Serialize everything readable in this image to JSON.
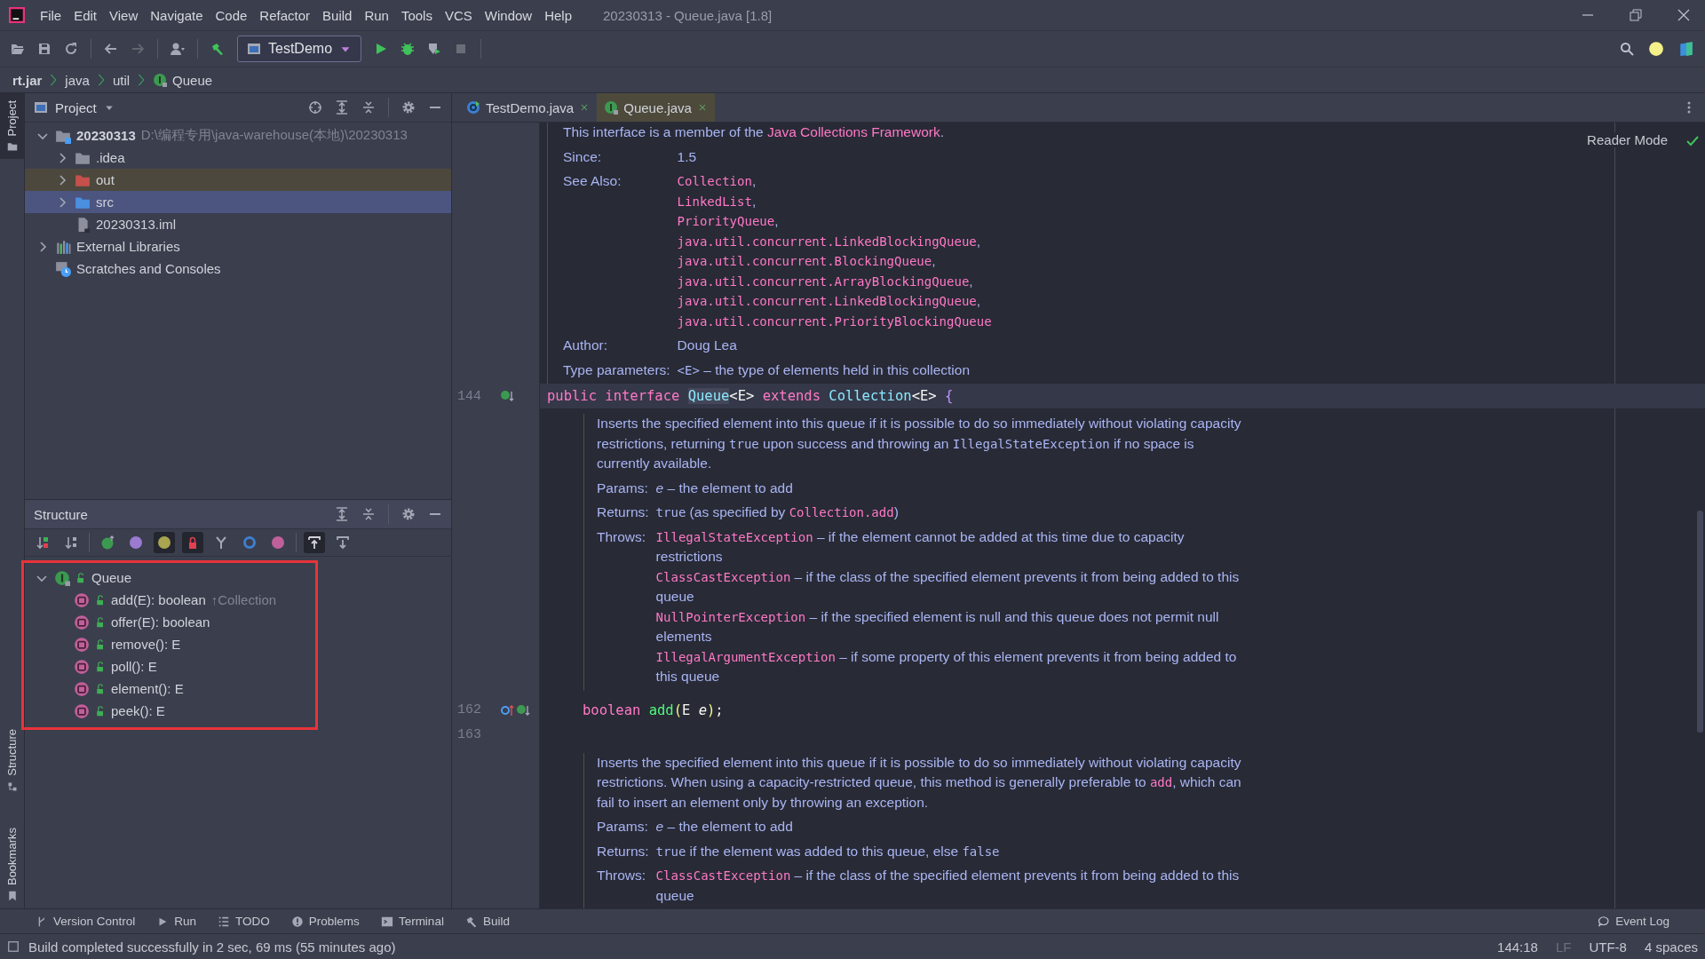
{
  "window": {
    "title": "20230313 - Queue.java [1.8]"
  },
  "menu": [
    "File",
    "Edit",
    "View",
    "Navigate",
    "Code",
    "Refactor",
    "Build",
    "Run",
    "Tools",
    "VCS",
    "Window",
    "Help"
  ],
  "toolbar": {
    "run_configuration": "TestDemo"
  },
  "breadcrumb": [
    {
      "label": "rt.jar",
      "bold": true,
      "kind": "jar"
    },
    {
      "label": "java",
      "bold": false,
      "kind": "package"
    },
    {
      "label": "util",
      "bold": false,
      "kind": "package"
    },
    {
      "label": "Queue",
      "bold": false,
      "kind": "interface"
    }
  ],
  "tool_stripe": [
    {
      "label": "Project",
      "selected": true,
      "kind": "project"
    },
    {
      "label": "Structure",
      "selected": false,
      "kind": "structure"
    },
    {
      "label": "Bookmarks",
      "selected": false,
      "kind": "bookmarks"
    }
  ],
  "project_panel": {
    "title": "Project",
    "tree": [
      {
        "label": "20230313",
        "path": "D:\\编程专用\\java-warehouse(本地)\\20230313",
        "kind": "module",
        "expanded": true,
        "selected": false,
        "children": [
          {
            "label": ".idea",
            "kind": "folder",
            "expanded": false,
            "selected": false
          },
          {
            "label": "out",
            "kind": "excluded",
            "expanded": false,
            "selected": false
          },
          {
            "label": "src",
            "kind": "source",
            "expanded": false,
            "selected": true
          },
          {
            "label": "20230313.iml",
            "kind": "file",
            "selected": false
          }
        ]
      },
      {
        "label": "External Libraries",
        "kind": "libraries",
        "expanded": false,
        "selected": false
      },
      {
        "label": "Scratches and Consoles",
        "kind": "scratches",
        "selected": false
      }
    ]
  },
  "structure_panel": {
    "title": "Structure",
    "highlighted": true,
    "tree": [
      {
        "label": "Queue",
        "kind": "interface",
        "expanded": true,
        "children": [
          {
            "label": "add(E): boolean",
            "kind": "method",
            "inherited_from": "↑Collection"
          },
          {
            "label": "offer(E): boolean",
            "kind": "method"
          },
          {
            "label": "remove(): E",
            "kind": "method"
          },
          {
            "label": "poll(): E",
            "kind": "method"
          },
          {
            "label": "element(): E",
            "kind": "method"
          },
          {
            "label": "peek(): E",
            "kind": "method"
          }
        ]
      }
    ]
  },
  "editor": {
    "tabs": [
      {
        "label": "TestDemo.java",
        "kind": "class",
        "selected": false
      },
      {
        "label": "Queue.java",
        "kind": "interface",
        "selected": true
      }
    ],
    "reader_mode": "Reader Mode",
    "blocks": [
      {
        "kind": "class-doc",
        "paragraph": [
          {
            "text": "This interface is a member of the ",
            "kind": "plain"
          },
          {
            "text": "Java Collections Framework",
            "kind": "link"
          },
          {
            "text": ".",
            "kind": "plain"
          }
        ],
        "fields": [
          {
            "label": "Since:",
            "lines": [
              [
                {
                  "text": "1.5",
                  "kind": "plain"
                }
              ]
            ]
          },
          {
            "label": "See Also:",
            "lines": [
              [
                {
                  "text": "Collection",
                  "kind": "code-link"
                },
                {
                  "text": ",",
                  "kind": "plain"
                }
              ],
              [
                {
                  "text": "LinkedList",
                  "kind": "code-link"
                },
                {
                  "text": ",",
                  "kind": "plain"
                }
              ],
              [
                {
                  "text": "PriorityQueue",
                  "kind": "code-link"
                },
                {
                  "text": ",",
                  "kind": "plain"
                }
              ],
              [
                {
                  "text": "java.util.concurrent.LinkedBlockingQueue",
                  "kind": "code-link"
                },
                {
                  "text": ",",
                  "kind": "plain"
                }
              ],
              [
                {
                  "text": "java.util.concurrent.BlockingQueue",
                  "kind": "code-link"
                },
                {
                  "text": ",",
                  "kind": "plain"
                }
              ],
              [
                {
                  "text": "java.util.concurrent.ArrayBlockingQueue",
                  "kind": "code-link"
                },
                {
                  "text": ",",
                  "kind": "plain"
                }
              ],
              [
                {
                  "text": "java.util.concurrent.LinkedBlockingQueue",
                  "kind": "code-link"
                },
                {
                  "text": ",",
                  "kind": "plain"
                }
              ],
              [
                {
                  "text": "java.util.concurrent.PriorityBlockingQueue",
                  "kind": "code-link"
                }
              ]
            ]
          },
          {
            "label": "Author:",
            "lines": [
              [
                {
                  "text": "Doug Lea",
                  "kind": "plain"
                }
              ]
            ]
          },
          {
            "label": "Type parameters:",
            "lines": [
              [
                {
                  "text": "<E>",
                  "kind": "code"
                },
                {
                  "text": " – the type of elements held in this collection",
                  "kind": "plain"
                }
              ]
            ]
          }
        ]
      },
      {
        "kind": "code",
        "number": "144",
        "current": true,
        "gutter_icons": [
          {
            "kind": "implemented"
          }
        ],
        "tokens": [
          {
            "text": "public interface ",
            "kind": "keyword"
          },
          {
            "text": "Queue",
            "kind": "usage"
          },
          {
            "text": "<E> ",
            "kind": "text"
          },
          {
            "text": "extends ",
            "kind": "keyword"
          },
          {
            "text": "Collection",
            "kind": "type"
          },
          {
            "text": "<E> ",
            "kind": "text"
          },
          {
            "text": "{",
            "kind": "brace"
          }
        ]
      },
      {
        "kind": "member-doc",
        "paragraph": [
          {
            "text": "Inserts the specified element into this queue if it is possible to do so immediately without violating capacity restrictions, returning ",
            "kind": "plain"
          },
          {
            "text": "true",
            "kind": "code"
          },
          {
            "text": " upon success and throwing an ",
            "kind": "plain"
          },
          {
            "text": "IllegalStateException",
            "kind": "code"
          },
          {
            "text": " if no space is currently available.",
            "kind": "plain"
          }
        ],
        "fields": [
          {
            "label": "Params:",
            "lines": [
              [
                {
                  "text": "e",
                  "kind": "italic"
                },
                {
                  "text": " – the element to add",
                  "kind": "plain"
                }
              ]
            ]
          },
          {
            "label": "Returns:",
            "lines": [
              [
                {
                  "text": "true",
                  "kind": "code"
                },
                {
                  "text": " (as specified by ",
                  "kind": "plain"
                },
                {
                  "text": "Collection.add",
                  "kind": "code-link"
                },
                {
                  "text": ")",
                  "kind": "plain"
                }
              ]
            ]
          },
          {
            "label": "Throws:",
            "lines": [
              [
                {
                  "text": "IllegalStateException",
                  "kind": "code-link"
                },
                {
                  "text": " – if the element cannot be added at this time due to capacity restrictions",
                  "kind": "plain"
                }
              ],
              [
                {
                  "text": "ClassCastException",
                  "kind": "code-link"
                },
                {
                  "text": " – if the class of the specified element prevents it from being added to this queue",
                  "kind": "plain"
                }
              ],
              [
                {
                  "text": "NullPointerException",
                  "kind": "code-link"
                },
                {
                  "text": " – if the specified element is null and this queue does not permit null elements",
                  "kind": "plain"
                }
              ],
              [
                {
                  "text": "IllegalArgumentException",
                  "kind": "code-link"
                },
                {
                  "text": " – if some property of this element prevents it from being added to this queue",
                  "kind": "plain"
                }
              ]
            ]
          }
        ]
      },
      {
        "kind": "member-code",
        "number": "162",
        "current": false,
        "gutter_icons": [
          {
            "kind": "overrides"
          },
          {
            "kind": "implemented"
          }
        ],
        "tokens": [
          {
            "text": "boolean ",
            "kind": "keyword"
          },
          {
            "text": "add",
            "kind": "method"
          },
          {
            "text": "(",
            "kind": "paren"
          },
          {
            "text": "E ",
            "kind": "text"
          },
          {
            "text": "e",
            "kind": "param"
          },
          {
            "text": ")",
            "kind": "paren"
          },
          {
            "text": ";",
            "kind": "text"
          }
        ]
      },
      {
        "kind": "member-code",
        "number": "163",
        "current": false
      },
      {
        "kind": "member-doc",
        "paragraph": [
          {
            "text": "Inserts the specified element into this queue if it is possible to do so immediately without violating capacity restrictions. When using a capacity-restricted queue, this method is generally preferable to ",
            "kind": "plain"
          },
          {
            "text": "add",
            "kind": "code-link"
          },
          {
            "text": ", which can fail to insert an element only by throwing an exception.",
            "kind": "plain"
          }
        ],
        "fields": [
          {
            "label": "Params:",
            "lines": [
              [
                {
                  "text": "e",
                  "kind": "italic"
                },
                {
                  "text": " – the element to add",
                  "kind": "plain"
                }
              ]
            ]
          },
          {
            "label": "Returns:",
            "lines": [
              [
                {
                  "text": "true",
                  "kind": "code"
                },
                {
                  "text": " if the element was added to this queue, else ",
                  "kind": "plain"
                },
                {
                  "text": "false",
                  "kind": "code"
                }
              ]
            ]
          },
          {
            "label": "Throws:",
            "lines": [
              [
                {
                  "text": "ClassCastException",
                  "kind": "code-link"
                },
                {
                  "text": " – if the class of the specified element prevents it from being added to this queue",
                  "kind": "plain"
                }
              ]
            ]
          }
        ]
      }
    ]
  },
  "tool_windows": [
    {
      "label": "Version Control",
      "kind": "vcs"
    },
    {
      "label": "Run",
      "kind": "run"
    },
    {
      "label": "TODO",
      "kind": "todo"
    },
    {
      "label": "Problems",
      "kind": "problems"
    },
    {
      "label": "Terminal",
      "kind": "terminal"
    },
    {
      "label": "Build",
      "kind": "build"
    }
  ],
  "event_log": "Event Log",
  "status_bar": {
    "message": "Build completed successfully in 2 sec, 69 ms (55 minutes ago)",
    "items": [
      {
        "label": "144:18",
        "dim": false
      },
      {
        "label": "LF",
        "dim": true
      },
      {
        "label": "UTF-8",
        "dim": false
      },
      {
        "label": "4 spaces",
        "dim": false
      }
    ]
  }
}
